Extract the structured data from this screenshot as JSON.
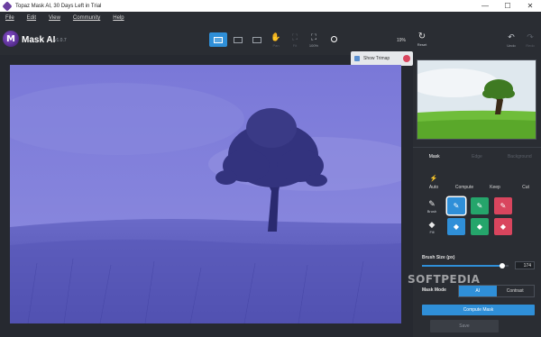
{
  "window": {
    "title": "Topaz Mask AI, 30 Days Left in Trial"
  },
  "menu": {
    "items": [
      "File",
      "Edit",
      "View",
      "Community",
      "Help"
    ]
  },
  "app": {
    "brand": "Mask AI",
    "version": "v1.0.7"
  },
  "toolbar": {
    "pan_label": "Pan",
    "fit_label": "Fit",
    "zoom100_label": "100%",
    "zoom_value": "19%",
    "reset_label": "Reset",
    "undo_label": "Undo",
    "redo_label": "Redo"
  },
  "trimap": {
    "label": "Show Trimap"
  },
  "panel": {
    "tabs": [
      "Mask",
      "Edge",
      "Background"
    ],
    "modes": [
      {
        "label": "Auto",
        "icon": "auto-icon"
      },
      {
        "label": "Compute",
        "icon": "compute-icon"
      },
      {
        "label": "Keep",
        "icon": "keep-icon"
      },
      {
        "label": "Cut",
        "icon": "cut-icon"
      }
    ],
    "brush_label": "Brush",
    "fill_label": "Fill",
    "brush_size_label": "Brush Size (px)",
    "brush_size_value": "174",
    "brush_size_fraction": 0.93,
    "mask_mode_label": "Mask Mode",
    "mask_mode_options": [
      "AI",
      "Contrast"
    ],
    "mask_mode_selected": "AI",
    "compute_mask_label": "Compute Mask",
    "save_label": "Save"
  },
  "watermark": "SOFTPEDIA",
  "colors": {
    "accent": "#2f8fd8",
    "keep": "#25a56b",
    "cut": "#d9455e",
    "overlay": "#5a55c8"
  }
}
